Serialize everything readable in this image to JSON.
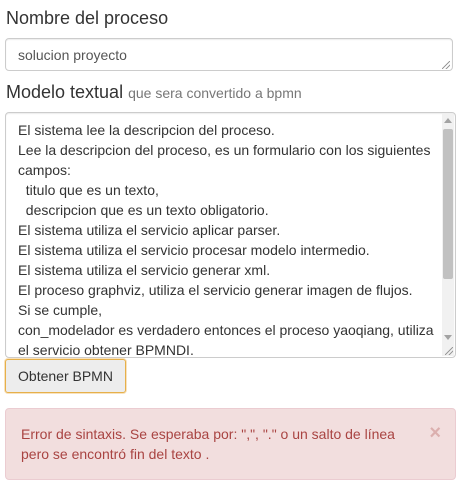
{
  "form": {
    "process_name_label": "Nombre del proceso",
    "process_name_value": "solucion proyecto",
    "model_label": "Modelo textual",
    "model_hint": "que sera convertido a bpmn",
    "model_text": "El sistema lee la descripcion del proceso.\nLee la descripcion del proceso, es un formulario con los siguientes campos:\n  titulo que es un texto,\n  descripcion que es un texto obligatorio.\nEl sistema utiliza el servicio aplicar parser.\nEl sistema utiliza el servicio procesar modelo intermedio.\nEl sistema utiliza el servicio generar xml.\nEl proceso graphviz, utiliza el servicio generar imagen de flujos.\nSi se cumple,\ncon_modelador es verdadero entonces el proceso yaoqiang, utiliza el servicio obtener BPMNDI.",
    "submit_label": "Obtener BPMN"
  },
  "alert": {
    "message": "Error de sintaxis. Se esperaba por: \",\", \".\" o un salto de línea pero se encontró fin del texto .",
    "close_symbol": "×",
    "background_color": "#f2dede",
    "text_color": "#a94442"
  },
  "icons": {
    "close": "close-icon",
    "resize": "resize-grip-icon"
  }
}
